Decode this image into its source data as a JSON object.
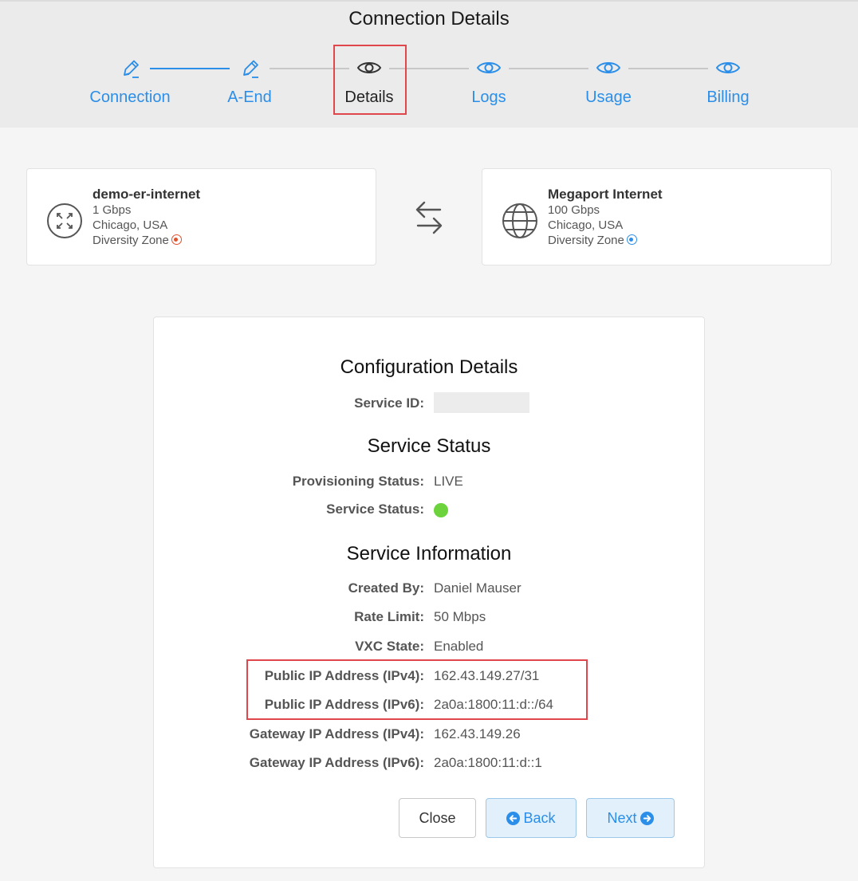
{
  "page": {
    "title": "Connection Details"
  },
  "steps": [
    {
      "label": "Connection",
      "icon": "pencil-icon"
    },
    {
      "label": "A-End",
      "icon": "pencil-icon"
    },
    {
      "label": "Details",
      "icon": "eye-icon"
    },
    {
      "label": "Logs",
      "icon": "eye-icon"
    },
    {
      "label": "Usage",
      "icon": "eye-icon"
    },
    {
      "label": "Billing",
      "icon": "eye-icon"
    }
  ],
  "a_end": {
    "name": "demo-er-internet",
    "speed": "1 Gbps",
    "location": "Chicago, USA",
    "diversity_zone": "Diversity Zone",
    "zone_color": "#e0502c",
    "icon": "port-icon"
  },
  "b_end": {
    "name": "Megaport Internet",
    "speed": "100 Gbps",
    "location": "Chicago, USA",
    "diversity_zone": "Diversity Zone",
    "zone_color": "#2b8ee8",
    "icon": "globe-icon"
  },
  "config": {
    "title": "Configuration Details",
    "service_id_label": "Service ID:",
    "status_title": "Service Status",
    "provisioning_label": "Provisioning Status:",
    "provisioning_value": "LIVE",
    "service_status_label": "Service Status:",
    "service_status_color": "#6cd33c",
    "info_title": "Service Information",
    "info": [
      {
        "label": "Created By:",
        "value": "Daniel Mauser"
      },
      {
        "label": "Rate Limit:",
        "value": "50 Mbps"
      },
      {
        "label": "VXC State:",
        "value": "Enabled"
      },
      {
        "label": "Public IP Address (IPv4):",
        "value": "162.43.149.27/31"
      },
      {
        "label": "Public IP Address (IPv6):",
        "value": "2a0a:1800:11:d::/64"
      },
      {
        "label": "Gateway IP Address (IPv4):",
        "value": "162.43.149.26"
      },
      {
        "label": "Gateway IP Address (IPv6):",
        "value": "2a0a:1800:11:d::1"
      }
    ]
  },
  "buttons": {
    "close": "Close",
    "back": "Back",
    "next": "Next"
  },
  "colors": {
    "accent": "#2b8ee8",
    "highlight": "#e0474c"
  }
}
